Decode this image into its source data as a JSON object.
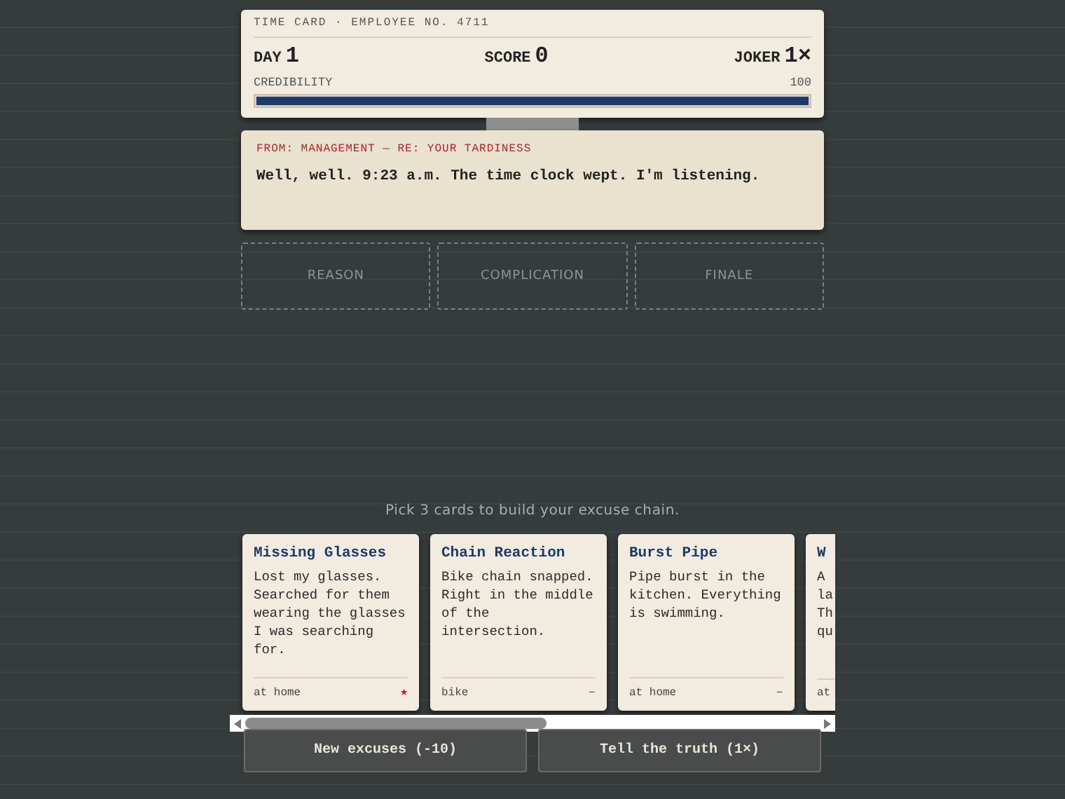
{
  "time_card": {
    "header": "TIME CARD · EMPLOYEE NO. 4711",
    "stats": [
      {
        "label": "DAY",
        "value": "1"
      },
      {
        "label": "SCORE",
        "value": "0"
      },
      {
        "label": "JOKER",
        "value": "1×"
      }
    ],
    "meter_label": "CREDIBILITY",
    "meter_reading": "100",
    "level": 1
  },
  "message": {
    "from": "FROM: MANAGEMENT — RE: YOUR TARDINESS",
    "text": "Well, well. 9:23 a.m. The time clock wept. I'm listening."
  },
  "slots": [
    "REASON",
    "COMPLICATION",
    "FINALE"
  ],
  "prompt": "Pick 3 cards to build your excuse chain.",
  "cards": [
    {
      "kind": "full",
      "title": "Missing Glasses",
      "body": "Lost my glasses. Searched for them wearing the glasses I was searching for.",
      "tag": "at home",
      "marker": "★"
    },
    {
      "kind": "full",
      "title": "Chain Reaction",
      "body": "Bike chain snapped. Right in the middle of the intersection.",
      "tag": "bike",
      "marker": "–"
    },
    {
      "kind": "full",
      "title": "Burst Pipe",
      "body": "Pipe burst in the kitchen. Everything is swimming.",
      "tag": "at home",
      "marker": "–"
    },
    {
      "kind": "partial",
      "title": "W",
      "lines": [
        "A",
        "la",
        "Th",
        "qu"
      ],
      "tag": "at"
    }
  ],
  "buttons": [
    "New excuses (-10)",
    "Tell the truth (1×)"
  ]
}
